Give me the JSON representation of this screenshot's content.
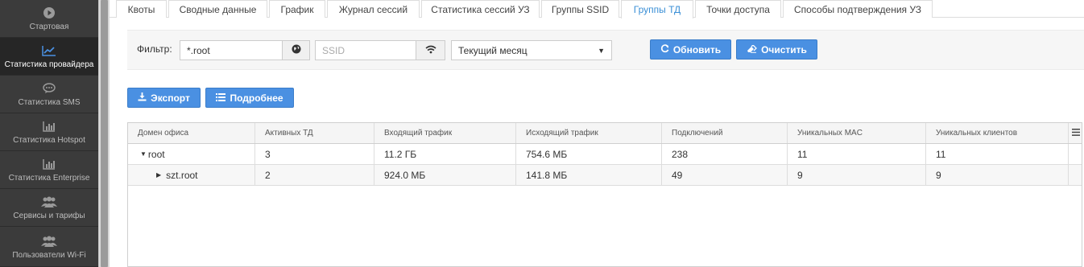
{
  "sidebar": {
    "items": [
      {
        "label": "Стартовая",
        "icon": "play-circle-icon"
      },
      {
        "label": "Статистика провайдера",
        "icon": "line-chart-icon",
        "active": true
      },
      {
        "label": "Статистика SMS",
        "icon": "chat-bubble-icon"
      },
      {
        "label": "Статистика Hotspot",
        "icon": "bar-chart-icon"
      },
      {
        "label": "Статистика Enterprise",
        "icon": "bar-chart-icon"
      },
      {
        "label": "Сервисы и тарифы",
        "icon": "users-icon"
      },
      {
        "label": "Пользователи Wi-Fi",
        "icon": "users-icon"
      }
    ]
  },
  "tabs": [
    {
      "label": "Квоты"
    },
    {
      "label": "Сводные данные"
    },
    {
      "label": "График"
    },
    {
      "label": "Журнал сессий"
    },
    {
      "label": "Статистика сессий УЗ"
    },
    {
      "label": "Группы SSID"
    },
    {
      "label": "Группы ТД",
      "active": true
    },
    {
      "label": "Точки доступа"
    },
    {
      "label": "Способы подтверждения УЗ"
    }
  ],
  "filter": {
    "label": "Фильтр:",
    "domain_value": "*.root",
    "ssid_placeholder": "SSID",
    "period_value": "Текущий месяц",
    "refresh_label": "Обновить",
    "clear_label": "Очистить"
  },
  "actions": {
    "export_label": "Экспорт",
    "details_label": "Подробнее"
  },
  "table": {
    "headers": [
      "Домен офиса",
      "Активных ТД",
      "Входящий трафик",
      "Исходящий трафик",
      "Подключений",
      "Уникальных MAC",
      "Уникальных клиентов"
    ],
    "rows": [
      {
        "domain": "root",
        "active_ap": "3",
        "incoming": "11.2 ГБ",
        "outgoing": "754.6 МБ",
        "connections": "238",
        "unique_mac": "11",
        "unique_clients": "11"
      },
      {
        "domain": "szt.root",
        "active_ap": "2",
        "incoming": "924.0 МБ",
        "outgoing": "141.8 МБ",
        "connections": "49",
        "unique_mac": "9",
        "unique_clients": "9"
      }
    ]
  },
  "colors": {
    "sidebar_bg": "#3b3b3b",
    "sidebar_active_bg": "#262626",
    "accent": "#4a90e2",
    "active_tab_text": "#3a8fd6"
  }
}
